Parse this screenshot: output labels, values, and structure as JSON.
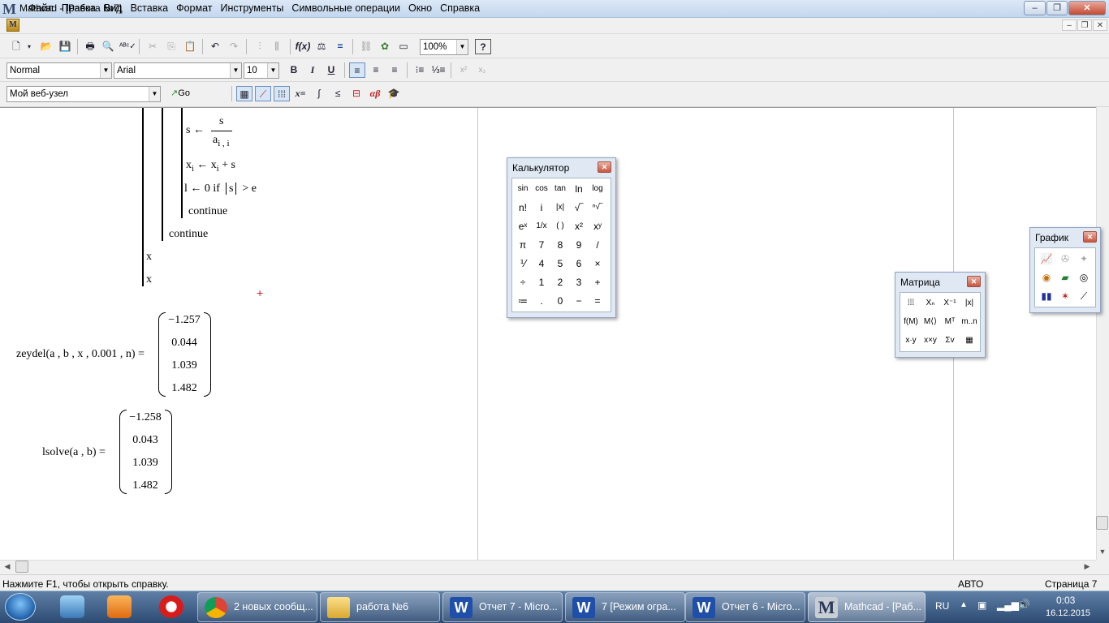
{
  "window": {
    "app_logo": "M",
    "title": "Mathcad - [Работа №7]",
    "min": "‒",
    "max": "❐",
    "close": "✕"
  },
  "menu": {
    "items": [
      "Файл",
      "Правка",
      "Вид",
      "Вставка",
      "Формат",
      "Инструменты",
      "Символьные операции",
      "Окно",
      "Справка"
    ],
    "mdi_min": "–",
    "mdi_restore": "❐",
    "mdi_close": "✕"
  },
  "toolbar_standard": {
    "zoom": "100%",
    "help": "?"
  },
  "toolbar_format": {
    "style": "Normal",
    "font": "Arial",
    "size": "10",
    "bold": "B",
    "italic": "I",
    "underline": "U"
  },
  "toolbar_web": {
    "site": "Мой веб-узел",
    "go": "Go"
  },
  "doc": {
    "s_assign": "s ←",
    "frac_num": "s",
    "frac_den": "a",
    "frac_den_sub": "i , i",
    "xi_line": "x",
    "xi_sub": "i",
    "xi_rest": "← x",
    "xi_sub2": "i",
    "xi_tail": "+ s",
    "l_line_a": "l ← 0  if",
    "l_line_s": "s",
    "l_line_b": "> e",
    "continue_inner": "continue",
    "continue_outer": "continue",
    "x1": "x",
    "x2": "x",
    "zeydel_label": "zeydel(a , b , x , 0.001 , n)  =",
    "zeydel_values": [
      "−1.257",
      "0.044",
      "1.039",
      "1.482"
    ],
    "lsolve_label": "lsolve(a , b)  =",
    "lsolve_values": [
      "−1.258",
      "0.043",
      "1.039",
      "1.482"
    ]
  },
  "status": {
    "help": "Нажмите F1, чтобы открыть справку.",
    "mode": "АВТО",
    "page": "Страница 7"
  },
  "calculator": {
    "title": "Калькулятор",
    "keys": [
      [
        "sin",
        "cos",
        "tan",
        "ln",
        "log"
      ],
      [
        "n!",
        "i",
        "|x|",
        "√‾",
        "ⁿ√‾"
      ],
      [
        "eˣ",
        "1/x",
        "( )",
        "x²",
        "xʸ"
      ],
      [
        "π",
        "7",
        "8",
        "9",
        "/"
      ],
      [
        "⅟",
        "4",
        "5",
        "6",
        "×"
      ],
      [
        "÷",
        "1",
        "2",
        "3",
        "+"
      ],
      [
        "≔",
        ".",
        "0",
        "−",
        "="
      ]
    ]
  },
  "matrix": {
    "title": "Матрица",
    "keys": [
      [
        "⁞⁞⁞",
        "Xₙ",
        "X⁻¹",
        "|x|"
      ],
      [
        "f(M)",
        "M⟨⟩",
        "Mᵀ",
        "m..n"
      ],
      [
        "x·y",
        "x×y",
        "Σv",
        "▦"
      ]
    ]
  },
  "graph": {
    "title": "График"
  },
  "taskbar": {
    "tasks": [
      "2 новых сообщ...",
      "работа №6",
      "Отчет 7 - Micro...",
      "7 [Режим огра...",
      "Отчет 6 - Micro...",
      "Mathcad - [Раб..."
    ],
    "lang": "RU",
    "time": "0:03",
    "date": "16.12.2015"
  }
}
